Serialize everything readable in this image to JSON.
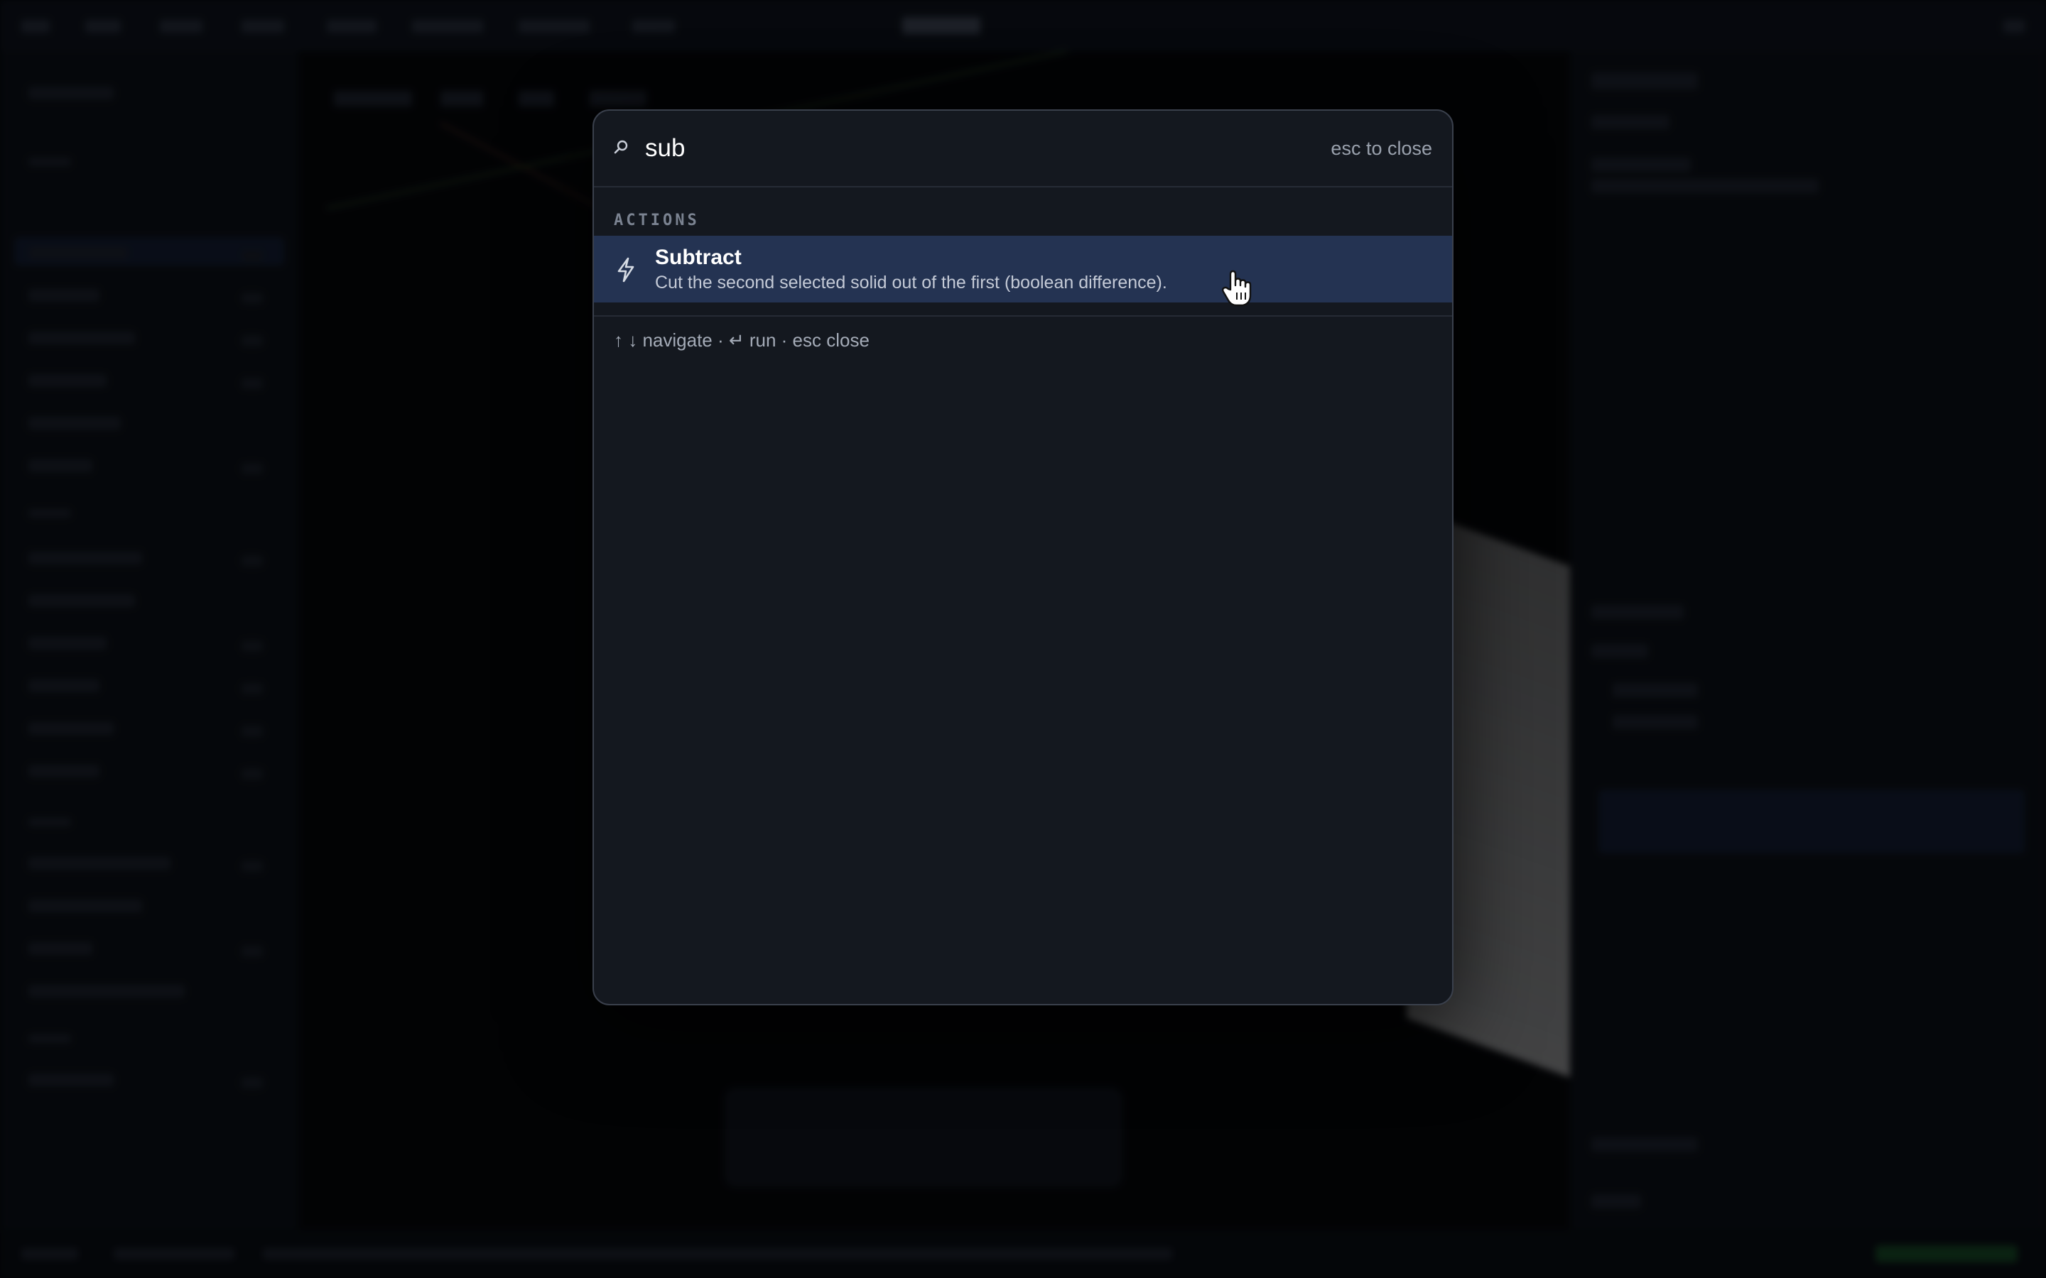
{
  "palette": {
    "query": "sub",
    "close_hint": "esc to close",
    "section_label": "ACTIONS",
    "results": [
      {
        "icon": "lightning-bolt-icon",
        "title": "Subtract",
        "description": "Cut the second selected solid out of the first (boolean difference)."
      }
    ],
    "footer_hint": "↑ ↓ navigate · ↵ run · esc close"
  },
  "colors": {
    "palette_bg": "#14181f",
    "selected_row": "#243352",
    "text_primary": "#ffffff",
    "text_muted": "#9aa1ad"
  }
}
